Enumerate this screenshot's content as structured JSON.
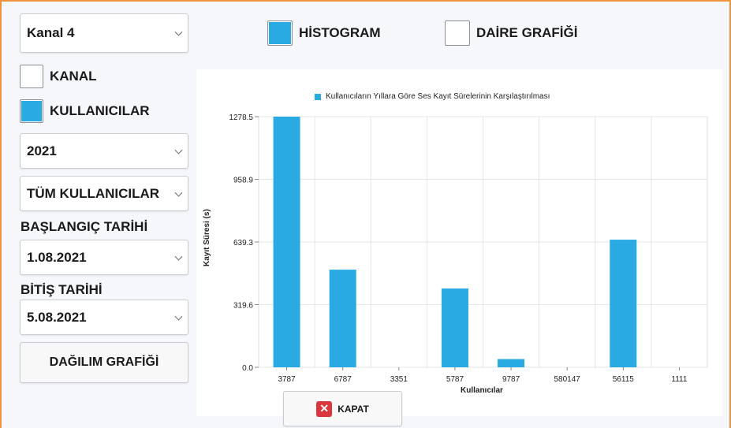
{
  "controls": {
    "channel_select": "Kanal 4",
    "histogram_label": "HİSTOGRAM",
    "pie_label": "DAİRE GRAFİĞİ",
    "kanal_label": "KANAL",
    "users_label": "KULLANICILAR",
    "year_select": "2021",
    "users_select": "TÜM KULLANICILAR",
    "start_label": "BAŞLANGIÇ TARİHİ",
    "start_date": "1.08.2021",
    "end_label": "BİTİŞ TARİHİ",
    "end_date": "5.08.2021",
    "distribution_button": "DAĞILIM GRAFİĞİ",
    "close_button": "KAPAT"
  },
  "state": {
    "histogram_checked": true,
    "pie_checked": false,
    "kanal_checked": false,
    "users_checked": true
  },
  "colors": {
    "accent": "#29aae2",
    "frame_border": "#f0953f",
    "close_icon": "#d9363e"
  },
  "chart_data": {
    "type": "bar",
    "title": "Kullanıcıların Yıllara Göre Ses Kayıt Sürelerinin Karşılaştırılması",
    "xlabel": "Kullanıcılar",
    "ylabel": "Kayıt Süresi (s)",
    "categories": [
      "3787",
      "6787",
      "3351",
      "5787",
      "9787",
      "580147",
      "56115",
      "1111"
    ],
    "values": [
      1278.5,
      498,
      0,
      402,
      42,
      0,
      651,
      0
    ],
    "yticks": [
      "0.0",
      "319.6",
      "639.3",
      "958.9",
      "1278.5"
    ],
    "ylim": [
      0,
      1278.5
    ],
    "grid": true,
    "legend": "top"
  }
}
